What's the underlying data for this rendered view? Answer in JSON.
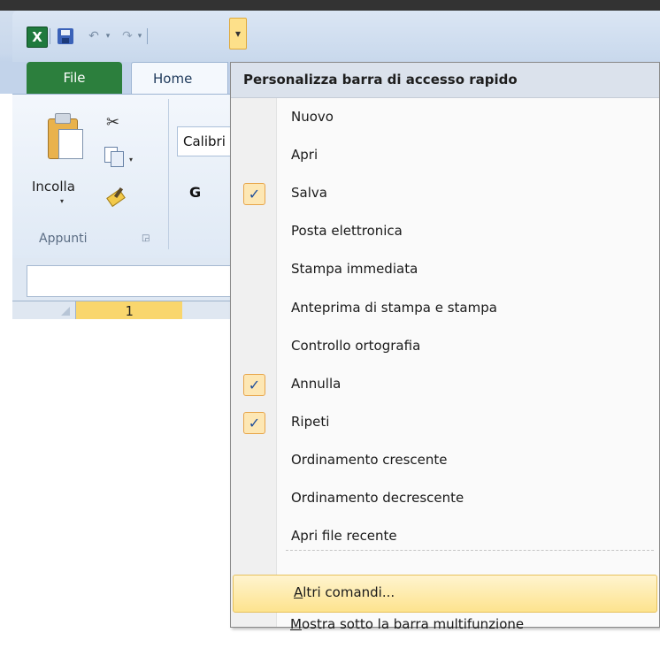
{
  "toolbar": {
    "app_icon_letter": "X",
    "undo_glyph": "↶",
    "redo_glyph": "↷",
    "dropdown_arrow": "▾",
    "customize_glyph": "▾"
  },
  "ribbon": {
    "tabs": {
      "file": "File",
      "home": "Home"
    },
    "clipboard": {
      "paste_label": "Incolla",
      "group_label": "Appunti",
      "cut_glyph": "✂"
    },
    "font": {
      "name": "Calibri",
      "bold": "G"
    }
  },
  "grid": {
    "column_header": "1"
  },
  "menu": {
    "title": "Personalizza barra di accesso rapido",
    "check_glyph": "✓",
    "items": [
      {
        "label": "Nuovo",
        "checked": false
      },
      {
        "label": "Apri",
        "checked": false
      },
      {
        "label": "Salva",
        "checked": true
      },
      {
        "label": "Posta elettronica",
        "checked": false
      },
      {
        "label": "Stampa immediata",
        "checked": false
      },
      {
        "label": "Anteprima di stampa e stampa",
        "checked": false
      },
      {
        "label": "Controllo ortografia",
        "checked": false
      },
      {
        "label": "Annulla",
        "checked": true
      },
      {
        "label": "Ripeti",
        "checked": true
      },
      {
        "label": "Ordinamento crescente",
        "checked": false
      },
      {
        "label": "Ordinamento decrescente",
        "checked": false
      },
      {
        "label": "Apri file recente",
        "checked": false
      }
    ],
    "more_commands": {
      "first": "A",
      "rest": "ltri comandi..."
    },
    "show_below": {
      "first": "M",
      "rest": "ostra sotto la barra multifunzione"
    }
  },
  "colors": {
    "accent": "#fde38e",
    "file_tab": "#2c7f3d",
    "check_blue": "#1f4e9b"
  }
}
